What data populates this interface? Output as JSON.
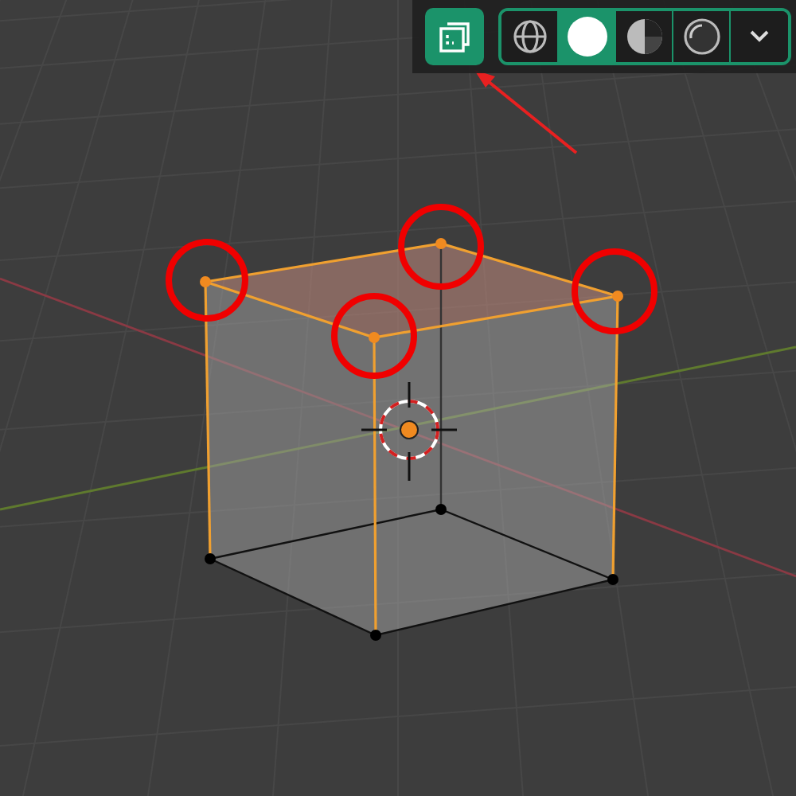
{
  "header": {
    "xray_toggle": {
      "on": true
    },
    "shading_modes": [
      {
        "kind": "wireframe",
        "selected": false
      },
      {
        "kind": "solid",
        "selected": true
      },
      {
        "kind": "material",
        "selected": false
      },
      {
        "kind": "rendered",
        "selected": false
      }
    ]
  }
}
